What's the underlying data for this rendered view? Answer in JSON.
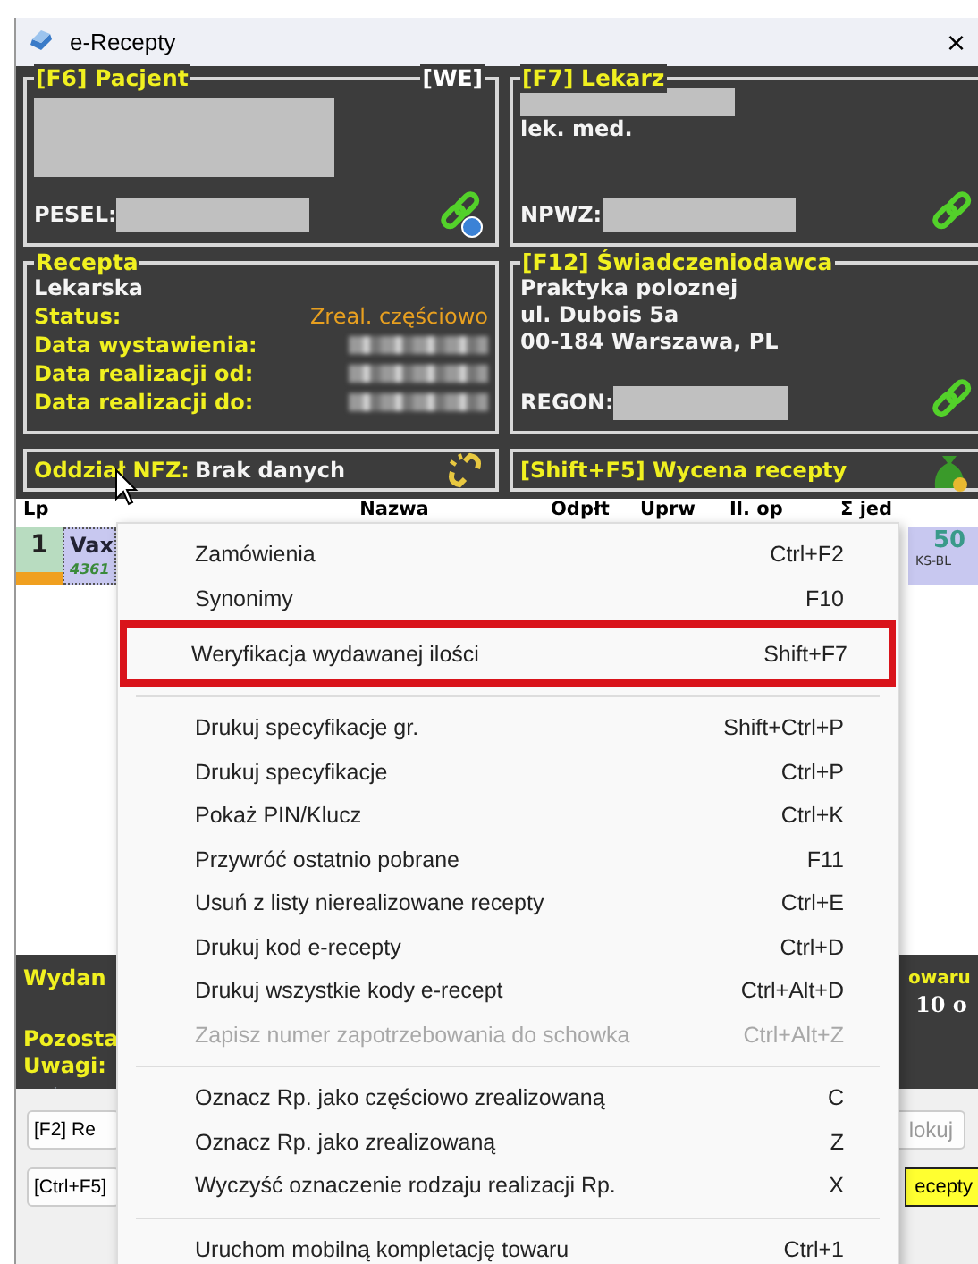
{
  "window": {
    "title": "e-Recepty",
    "close": "×"
  },
  "patient": {
    "title": "[F6] Pacjent",
    "tag": "[WE]",
    "pesel_label": "PESEL:"
  },
  "doctor": {
    "title": "[F7] Lekarz",
    "degree": "lek. med.",
    "npwz_label": "NPWZ:"
  },
  "prescription": {
    "title": "Recepta",
    "type": "Lekarska",
    "rows": [
      {
        "label": "Status:",
        "value": "Zreal. częściowo",
        "kind": "text"
      },
      {
        "label": "Data wystawienia:",
        "kind": "blurred"
      },
      {
        "label": "Data realizacji od:",
        "kind": "blurred"
      },
      {
        "label": "Data realizacji do:",
        "kind": "blurred"
      }
    ]
  },
  "provider": {
    "title": "[F12] Świadczeniodawca",
    "lines": [
      "Praktyka poloznej",
      "ul. Dubois 5a",
      "00-184 Warszawa, PL"
    ],
    "regon_label": "REGON:"
  },
  "nfz": {
    "label": "Oddział NFZ:",
    "value": "Brak danych"
  },
  "pricing": {
    "label": "[Shift+F5] Wycena recepty"
  },
  "table": {
    "columns": [
      "Lp",
      "Nazwa",
      "Odpłt",
      "Uprw",
      "Il. op",
      "Σ jed"
    ],
    "rows": [
      {
        "lp": "1",
        "name": "Vax",
        "code": "4361",
        "amount": "50",
        "tag": "KS-BL"
      }
    ]
  },
  "summary": {
    "left": [
      "Wydan",
      "Pozosta",
      "Uwagi:"
    ],
    "right": [
      "owaru",
      "10 o"
    ]
  },
  "buttons": {
    "row1": [
      "[F2] Re",
      "lokuj"
    ],
    "row2": [
      "[Ctrl+F5]",
      "ecepty"
    ]
  },
  "context_menu": [
    {
      "kind": "item",
      "label": "Zamówienia",
      "shortcut": "Ctrl+F2",
      "disabled": false,
      "highlighted": false
    },
    {
      "kind": "item",
      "label": "Synonimy",
      "shortcut": "F10",
      "disabled": false,
      "highlighted": false
    },
    {
      "kind": "item",
      "label": "Weryfikacja wydawanej ilości",
      "shortcut": "Shift+F7",
      "disabled": false,
      "highlighted": true
    },
    {
      "kind": "separator"
    },
    {
      "kind": "item",
      "label": "Drukuj specyfikacje gr.",
      "shortcut": "Shift+Ctrl+P",
      "disabled": false,
      "highlighted": false
    },
    {
      "kind": "item",
      "label": "Drukuj specyfikacje",
      "shortcut": "Ctrl+P",
      "disabled": false,
      "highlighted": false
    },
    {
      "kind": "item",
      "label": "Pokaż PIN/Klucz",
      "shortcut": "Ctrl+K",
      "disabled": false,
      "highlighted": false
    },
    {
      "kind": "item",
      "label": "Przywróć ostatnio pobrane",
      "shortcut": "F11",
      "disabled": false,
      "highlighted": false
    },
    {
      "kind": "item",
      "label": "Usuń z listy nierealizowane recepty",
      "shortcut": "Ctrl+E",
      "disabled": false,
      "highlighted": false
    },
    {
      "kind": "item",
      "label": "Drukuj kod e-recepty",
      "shortcut": "Ctrl+D",
      "disabled": false,
      "highlighted": false
    },
    {
      "kind": "item",
      "label": "Drukuj wszystkie kody e-recept",
      "shortcut": "Ctrl+Alt+D",
      "disabled": false,
      "highlighted": false
    },
    {
      "kind": "item",
      "label": "Zapisz numer zapotrzebowania do schowka",
      "shortcut": "Ctrl+Alt+Z",
      "disabled": true,
      "highlighted": false
    },
    {
      "kind": "separator"
    },
    {
      "kind": "item",
      "label": "Oznacz Rp. jako częściowo zrealizowaną",
      "shortcut": "C",
      "disabled": false,
      "highlighted": false
    },
    {
      "kind": "item",
      "label": "Oznacz Rp. jako zrealizowaną",
      "shortcut": "Z",
      "disabled": false,
      "highlighted": false
    },
    {
      "kind": "item",
      "label": "Wyczyść oznaczenie rodzaju realizacji Rp.",
      "shortcut": "X",
      "disabled": false,
      "highlighted": false
    },
    {
      "kind": "separator"
    },
    {
      "kind": "item",
      "label": "Uruchom mobilną kompletację towaru",
      "shortcut": "Ctrl+1",
      "disabled": false,
      "highlighted": false
    }
  ]
}
